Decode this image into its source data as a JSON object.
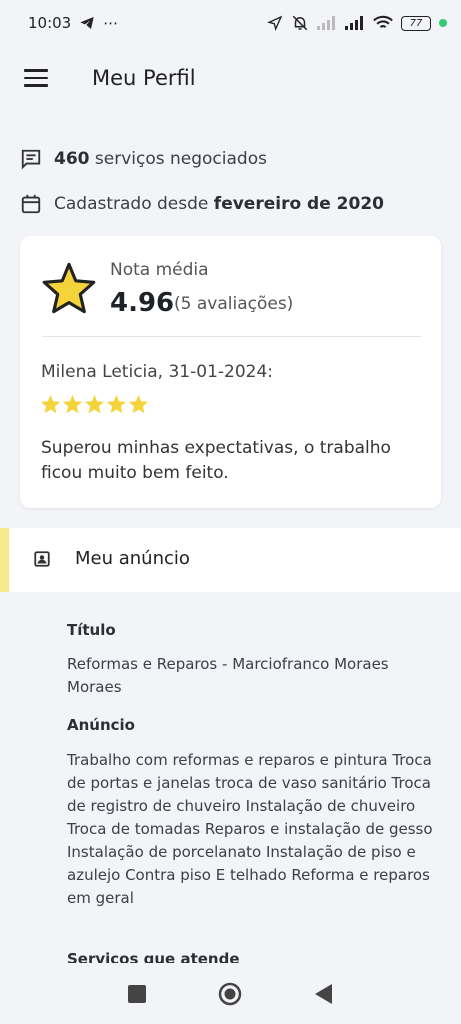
{
  "status_bar": {
    "time": "10:03",
    "more": "⋯",
    "battery": "77"
  },
  "header": {
    "title": "Meu Perfil"
  },
  "stats": {
    "services_count": "460",
    "services_label": "serviços negociados",
    "registered_prefix": "Cadastrado desde",
    "registered_date": "fevereiro de 2020"
  },
  "rating": {
    "label": "Nota média",
    "value": "4.96",
    "count": "(5 avaliações)",
    "review": {
      "author": "Milena Leticia, 31-01-2024:",
      "stars": 5,
      "text": "Superou minhas expectativas, o trabalho ficou muito bem feito."
    }
  },
  "section": {
    "title": "Meu anúncio"
  },
  "ad": {
    "title_label": "Título",
    "title_value": "Reformas e Reparos - Marciofranco Moraes Moraes",
    "ad_label": "Anúncio",
    "ad_value": "Trabalho com reformas e reparos e pintura Troca de portas e janelas troca de vaso sanitário Troca de registro de chuveiro Instalação de chuveiro Troca de tomadas Reparos e instalação de gesso Instalação de porcelanato Instalação de piso e azulejo Contra piso E telhado Reforma e reparos em geral",
    "services_label": "Serviços que atende"
  },
  "colors": {
    "star": "#f5d33a",
    "accent": "#f7ea8c"
  }
}
